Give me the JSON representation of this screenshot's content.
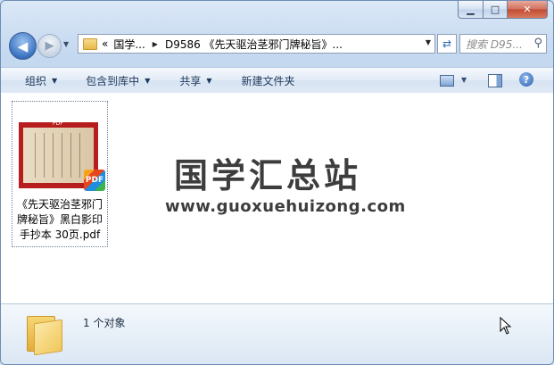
{
  "window": {
    "controls": {
      "minimize": "▁",
      "maximize": "□",
      "close": "✕"
    }
  },
  "nav": {
    "back_icon": "arrow-left-icon",
    "forward_icon": "arrow-right-icon",
    "address": {
      "overflow": "«",
      "crumb1": "国学...",
      "crumb2": "D9586 《先天驱治茎邪门牌秘旨》..."
    },
    "search_placeholder": "搜索 D95..."
  },
  "toolbar": {
    "organize": "组织",
    "include_library": "包含到库中",
    "share": "共享",
    "new_folder": "新建文件夹"
  },
  "content": {
    "file": {
      "thumb_tag": "PDF",
      "badge": "PDF",
      "name": "《先天驱治茎邪门牌秘旨》黑白影印手抄本 30页.pdf"
    },
    "watermark_cn": "国学汇总站",
    "watermark_url": "www.guoxuehuizong.com"
  },
  "details": {
    "count_text": "1 个对象"
  }
}
